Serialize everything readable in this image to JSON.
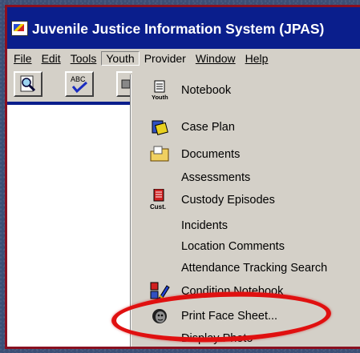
{
  "window": {
    "title": "Juvenile Justice Information System (JPAS)"
  },
  "menubar": {
    "items": [
      {
        "label": "File",
        "icon": "file-menu"
      },
      {
        "label": "Edit",
        "icon": "edit-menu"
      },
      {
        "label": "Tools",
        "icon": "tools-menu"
      },
      {
        "label": "Youth",
        "icon": "youth-menu"
      },
      {
        "label": "Provider",
        "icon": "provider-menu"
      },
      {
        "label": "Window",
        "icon": "window-menu"
      },
      {
        "label": "Help",
        "icon": "help-menu"
      }
    ],
    "active": "Youth"
  },
  "toolbar": {
    "buttons": [
      {
        "icon": "search-icon"
      },
      {
        "icon": "spellcheck-icon",
        "label": "ABC"
      },
      {
        "icon": "print-icon"
      }
    ]
  },
  "dropdown": {
    "items": [
      {
        "label": "Notebook",
        "icon": "notebook-icon",
        "icon_text": "Youth"
      },
      {
        "label": "Case Plan",
        "icon": "case-plan-icon"
      },
      {
        "label": "Documents",
        "icon": "folder-icon"
      },
      {
        "label": "Assessments",
        "icon": ""
      },
      {
        "label": "Custody Episodes",
        "icon": "custody-icon",
        "icon_text": "Cust."
      },
      {
        "label": "Incidents",
        "icon": ""
      },
      {
        "label": "Location Comments",
        "icon": ""
      },
      {
        "label": "Attendance Tracking Search",
        "icon": ""
      },
      {
        "label": "Condition Notebook",
        "icon": "condition-notebook-icon"
      },
      {
        "label": "Print Face Sheet...",
        "icon": "face-sheet-icon"
      },
      {
        "label": "Display Photo",
        "icon": ""
      }
    ],
    "highlight_color": "#e01010"
  }
}
